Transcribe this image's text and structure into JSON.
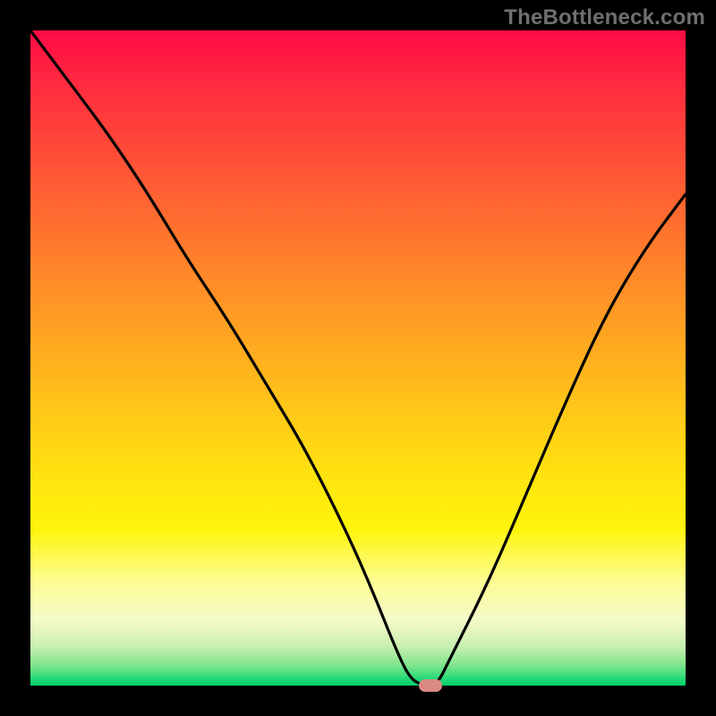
{
  "watermark": "TheBottleneck.com",
  "colors": {
    "frame_bg": "#000000",
    "curve_stroke": "#000000",
    "marker_fill": "#d98b82"
  },
  "chart_data": {
    "type": "line",
    "title": "",
    "xlabel": "",
    "ylabel": "",
    "xlim": [
      0,
      100
    ],
    "ylim": [
      0,
      100
    ],
    "series": [
      {
        "name": "bottleneck-curve",
        "x": [
          0,
          6,
          12,
          18,
          24,
          30,
          36,
          42,
          48,
          52,
          56,
          58,
          60,
          62,
          64,
          70,
          76,
          82,
          88,
          94,
          100
        ],
        "values": [
          100,
          92,
          84,
          75,
          65,
          56,
          46,
          36,
          24,
          15,
          5,
          1,
          0,
          0,
          4,
          16,
          30,
          44,
          57,
          67,
          75
        ]
      }
    ],
    "annotations": [
      {
        "name": "minimum-marker",
        "type": "lozenge",
        "x": 61,
        "y": 0,
        "color": "#d98b82"
      }
    ]
  }
}
